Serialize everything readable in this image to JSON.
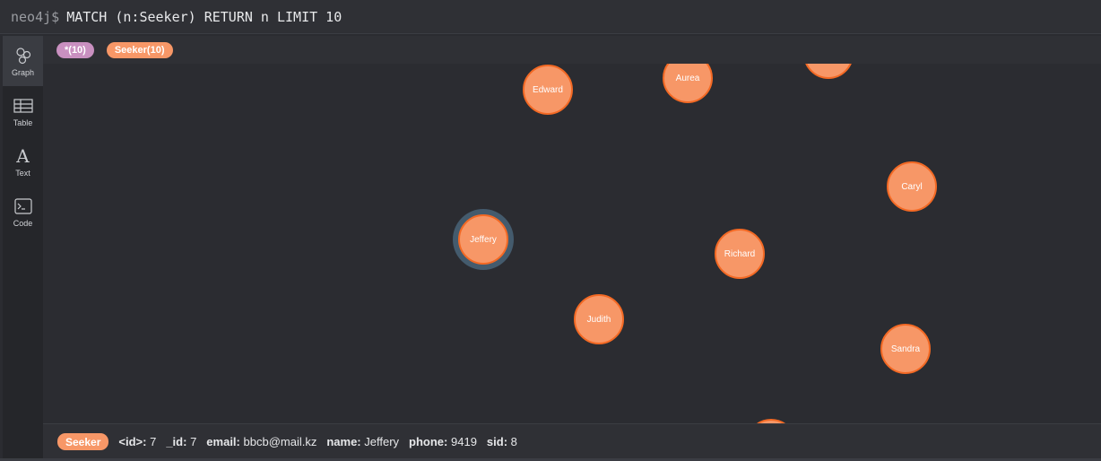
{
  "query": {
    "prompt": "neo4j$",
    "text": "MATCH (n:Seeker) RETURN n LIMIT 10"
  },
  "nav": {
    "items": [
      {
        "label": "Graph",
        "icon": "graph-icon",
        "active": true
      },
      {
        "label": "Table",
        "icon": "table-icon",
        "active": false
      },
      {
        "label": "Text",
        "icon": "text-icon",
        "active": false
      },
      {
        "label": "Code",
        "icon": "code-icon",
        "active": false
      }
    ]
  },
  "filters": {
    "all": "*(10)",
    "seeker": "Seeker(10)"
  },
  "graph": {
    "nodes": [
      {
        "name": "Edward"
      },
      {
        "name": "Aurea"
      },
      {
        "name": ""
      },
      {
        "name": "Caryl"
      },
      {
        "name": "Jeffery",
        "selected": true
      },
      {
        "name": "Richard"
      },
      {
        "name": "Judith"
      },
      {
        "name": "Sandra"
      },
      {
        "name": ""
      }
    ]
  },
  "status": {
    "label": "Seeker",
    "props": [
      {
        "key": "<id>:",
        "value": "7"
      },
      {
        "key": "_id:",
        "value": "7"
      },
      {
        "key": "email:",
        "value": "bbcb@mail.kz"
      },
      {
        "key": "name:",
        "value": "Jeffery"
      },
      {
        "key": "phone:",
        "value": "9419"
      },
      {
        "key": "sid:",
        "value": "8"
      }
    ]
  },
  "colors": {
    "node_fill": "#f79767",
    "node_border": "#f36924",
    "all_pill": "#c990c0",
    "selected_ring": "#445b6d"
  }
}
